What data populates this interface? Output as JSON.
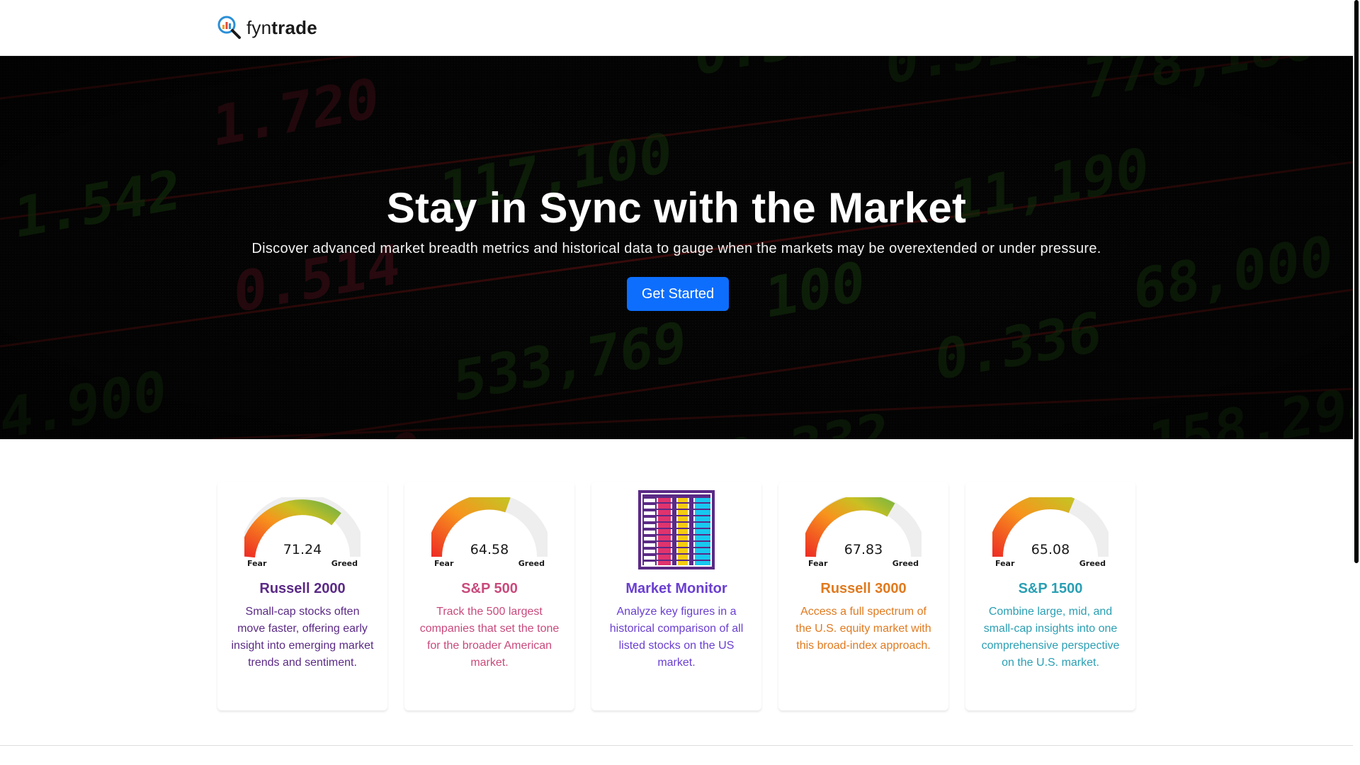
{
  "brand": {
    "name_light": "fyn",
    "name_bold": "trade",
    "icon": "magnifier-chart-icon"
  },
  "hero": {
    "title": "Stay in Sync with the Market",
    "subtitle": "Discover advanced market breadth metrics and historical data to gauge when the markets may be overextended or under pressure.",
    "cta_label": "Get Started",
    "cta_color": "#0d6efd"
  },
  "gauge_labels": {
    "low": "Fear",
    "high": "Greed"
  },
  "cards": [
    {
      "title": "Russell 2000",
      "description": "Small-cap stocks often move faster, offering early insight into emerging market trends and sentiment.",
      "value": "71.24",
      "color": "#5b2a86",
      "icon": "fear-greed-gauge-icon"
    },
    {
      "title": "S&P 500",
      "description": "Track the 500 largest companies that set the tone for the broader American market.",
      "value": "64.58",
      "color": "#c94a7c",
      "icon": "fear-greed-gauge-icon"
    },
    {
      "title": "Market Monitor",
      "description": "Analyze key figures in a historical comparison of all listed stocks on the US market.",
      "color": "#6a3fd1",
      "icon": "heatmap-grid-icon"
    },
    {
      "title": "Russell 3000",
      "description": "Access a full spectrum of the U.S. equity market with this broad-index approach.",
      "value": "67.83",
      "color": "#e07a1f",
      "icon": "fear-greed-gauge-icon"
    },
    {
      "title": "S&P 1500",
      "description": "Combine large, mid, and small-cap insights into one comprehensive perspective on the U.S. market.",
      "value": "65.08",
      "color": "#2a9fb3",
      "icon": "fear-greed-gauge-icon"
    }
  ]
}
